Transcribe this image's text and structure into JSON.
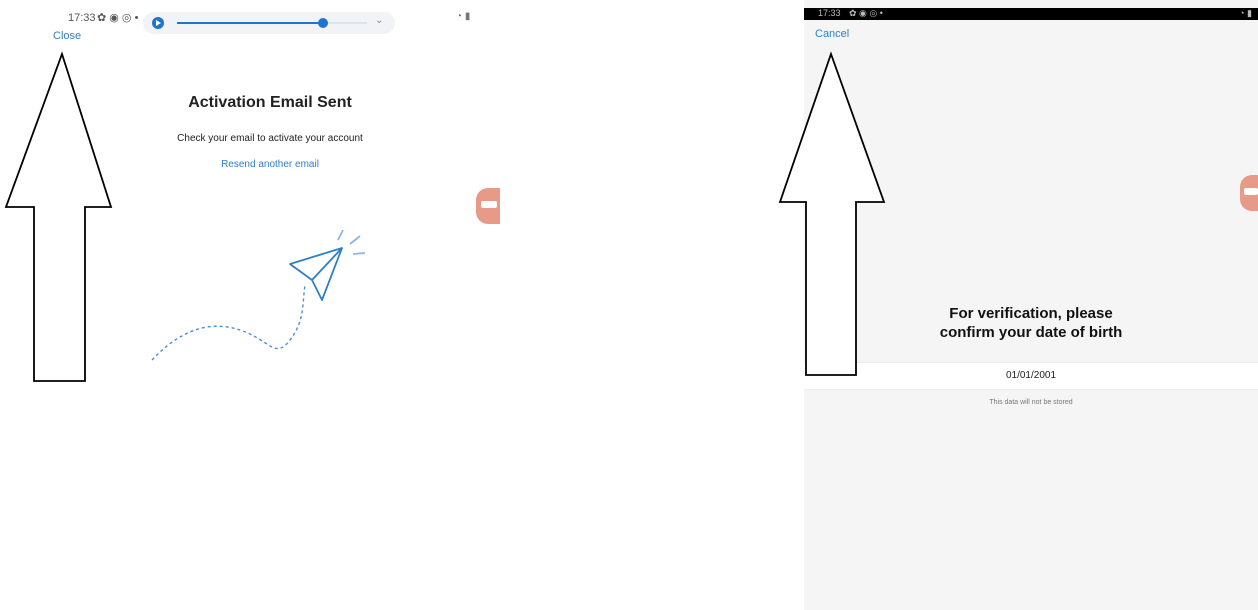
{
  "left_screen": {
    "status": {
      "time": "17:33",
      "icons": [
        "gear-icon",
        "messenger-icon",
        "at-icon",
        "dot-icon"
      ],
      "right_icons": "wifi-signal-icons"
    },
    "close_label": "Close",
    "media": {
      "progress": 0.77
    },
    "title": "Activation Email Sent",
    "subtitle": "Check your email to activate your account",
    "resend_label": "Resend another email"
  },
  "right_screen": {
    "status": {
      "time": "17:33"
    },
    "cancel_label": "Cancel",
    "verify_title": "For verification, please confirm your date of birth",
    "dob_value": "01/01/2001",
    "dob_note": "This data will not be stored"
  },
  "colors": {
    "link": "#2f7fc7",
    "accent": "#1f75cb",
    "bubble": "#e79a87"
  }
}
